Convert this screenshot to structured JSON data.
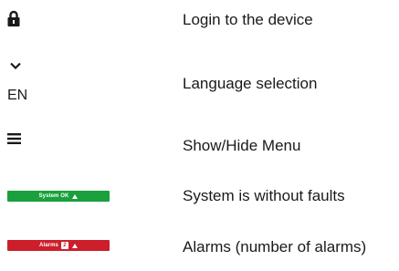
{
  "legend": {
    "login": {
      "icon": "lock-icon",
      "description": "Login to the device"
    },
    "language": {
      "icon": "chevron-down-icon",
      "value": "EN",
      "description": "Language selection"
    },
    "menu": {
      "icon": "hamburger-menu-icon",
      "description": "Show/Hide Menu"
    },
    "system_ok": {
      "badge_label": "System OK",
      "badge_color": "#1aa03c",
      "icon": "warning-triangle-icon",
      "description": "System is without faults"
    },
    "alarms": {
      "badge_label": "Alarms",
      "count": "2",
      "badge_color": "#cc1f2b",
      "icon": "warning-triangle-icon",
      "description": "Alarms (number of alarms)"
    }
  }
}
